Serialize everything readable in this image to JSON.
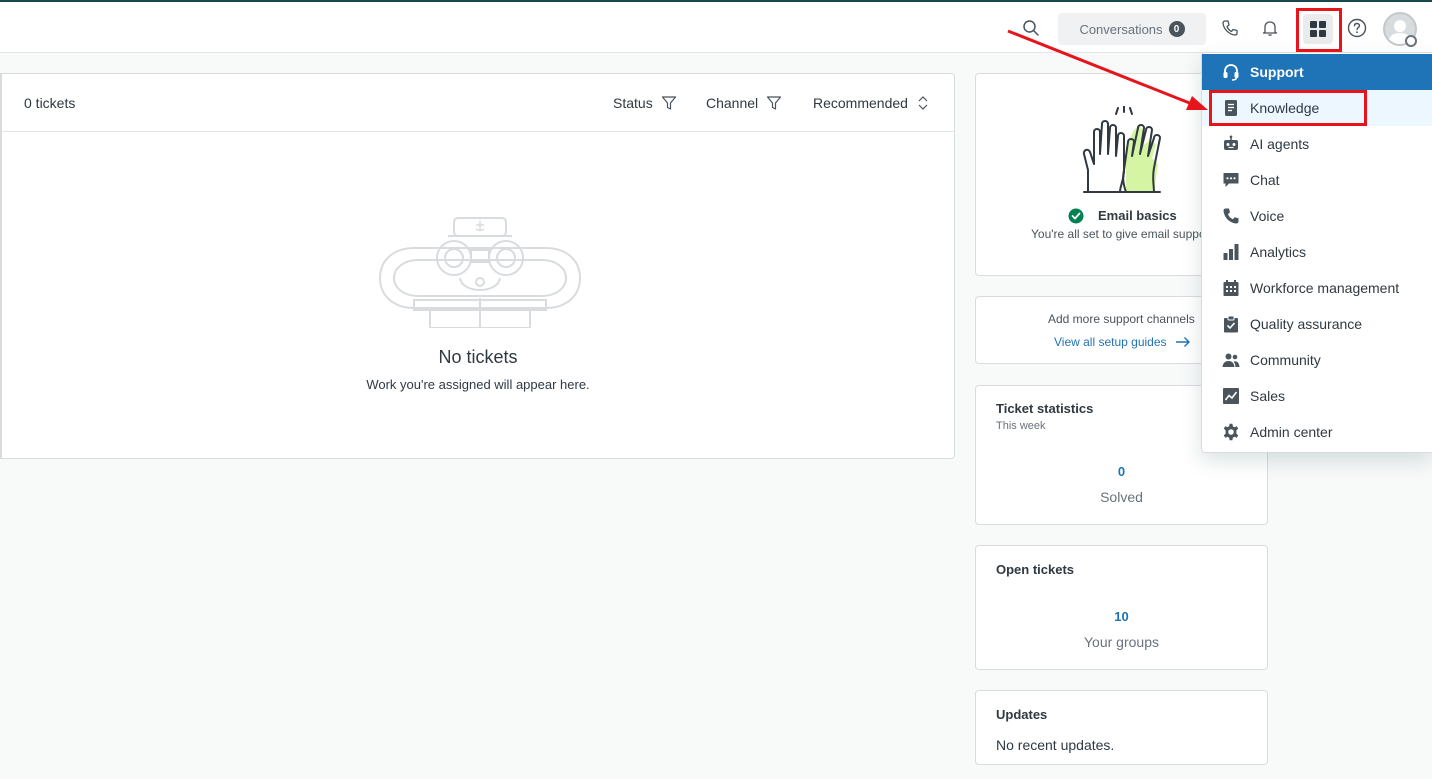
{
  "topbar": {
    "conversations_label": "Conversations",
    "conversations_count": "0",
    "icons": [
      "search-icon",
      "phone-icon",
      "bell-icon",
      "apps-grid-icon",
      "help-icon",
      "avatar"
    ]
  },
  "tickets": {
    "count_label": "0 tickets",
    "filters": [
      {
        "label": "Status",
        "icon": "filter-icon"
      },
      {
        "label": "Channel",
        "icon": "filter-icon"
      },
      {
        "label": "Recommended",
        "icon": "sort-icon"
      }
    ],
    "empty_title": "No tickets",
    "empty_subtitle": "Work you're assigned will appear here."
  },
  "cards": {
    "email": {
      "title": "Email basics",
      "subtitle": "You're all set to give email suppo"
    },
    "channels": {
      "text": "Add more support channels",
      "link": "View all setup guides"
    },
    "stats": {
      "title": "Ticket statistics",
      "subtitle": "This week",
      "value": "0",
      "label": "Solved"
    },
    "open": {
      "title": "Open tickets",
      "value": "10",
      "label": "Your groups"
    },
    "updates": {
      "title": "Updates",
      "text": "No recent updates."
    }
  },
  "menu": {
    "items": [
      {
        "label": "Support",
        "icon": "headset-icon"
      },
      {
        "label": "Knowledge",
        "icon": "book-icon"
      },
      {
        "label": "AI agents",
        "icon": "robot-icon"
      },
      {
        "label": "Chat",
        "icon": "chat-icon"
      },
      {
        "label": "Voice",
        "icon": "phone-icon"
      },
      {
        "label": "Analytics",
        "icon": "bar-chart-icon"
      },
      {
        "label": "Workforce management",
        "icon": "calendar-icon"
      },
      {
        "label": "Quality assurance",
        "icon": "clipboard-check-icon"
      },
      {
        "label": "Community",
        "icon": "people-icon"
      },
      {
        "label": "Sales",
        "icon": "trend-icon"
      },
      {
        "label": "Admin center",
        "icon": "gear-icon"
      }
    ]
  },
  "colors": {
    "accent": "#1f73b7",
    "annotation": "#e8141b",
    "success": "#038153"
  }
}
